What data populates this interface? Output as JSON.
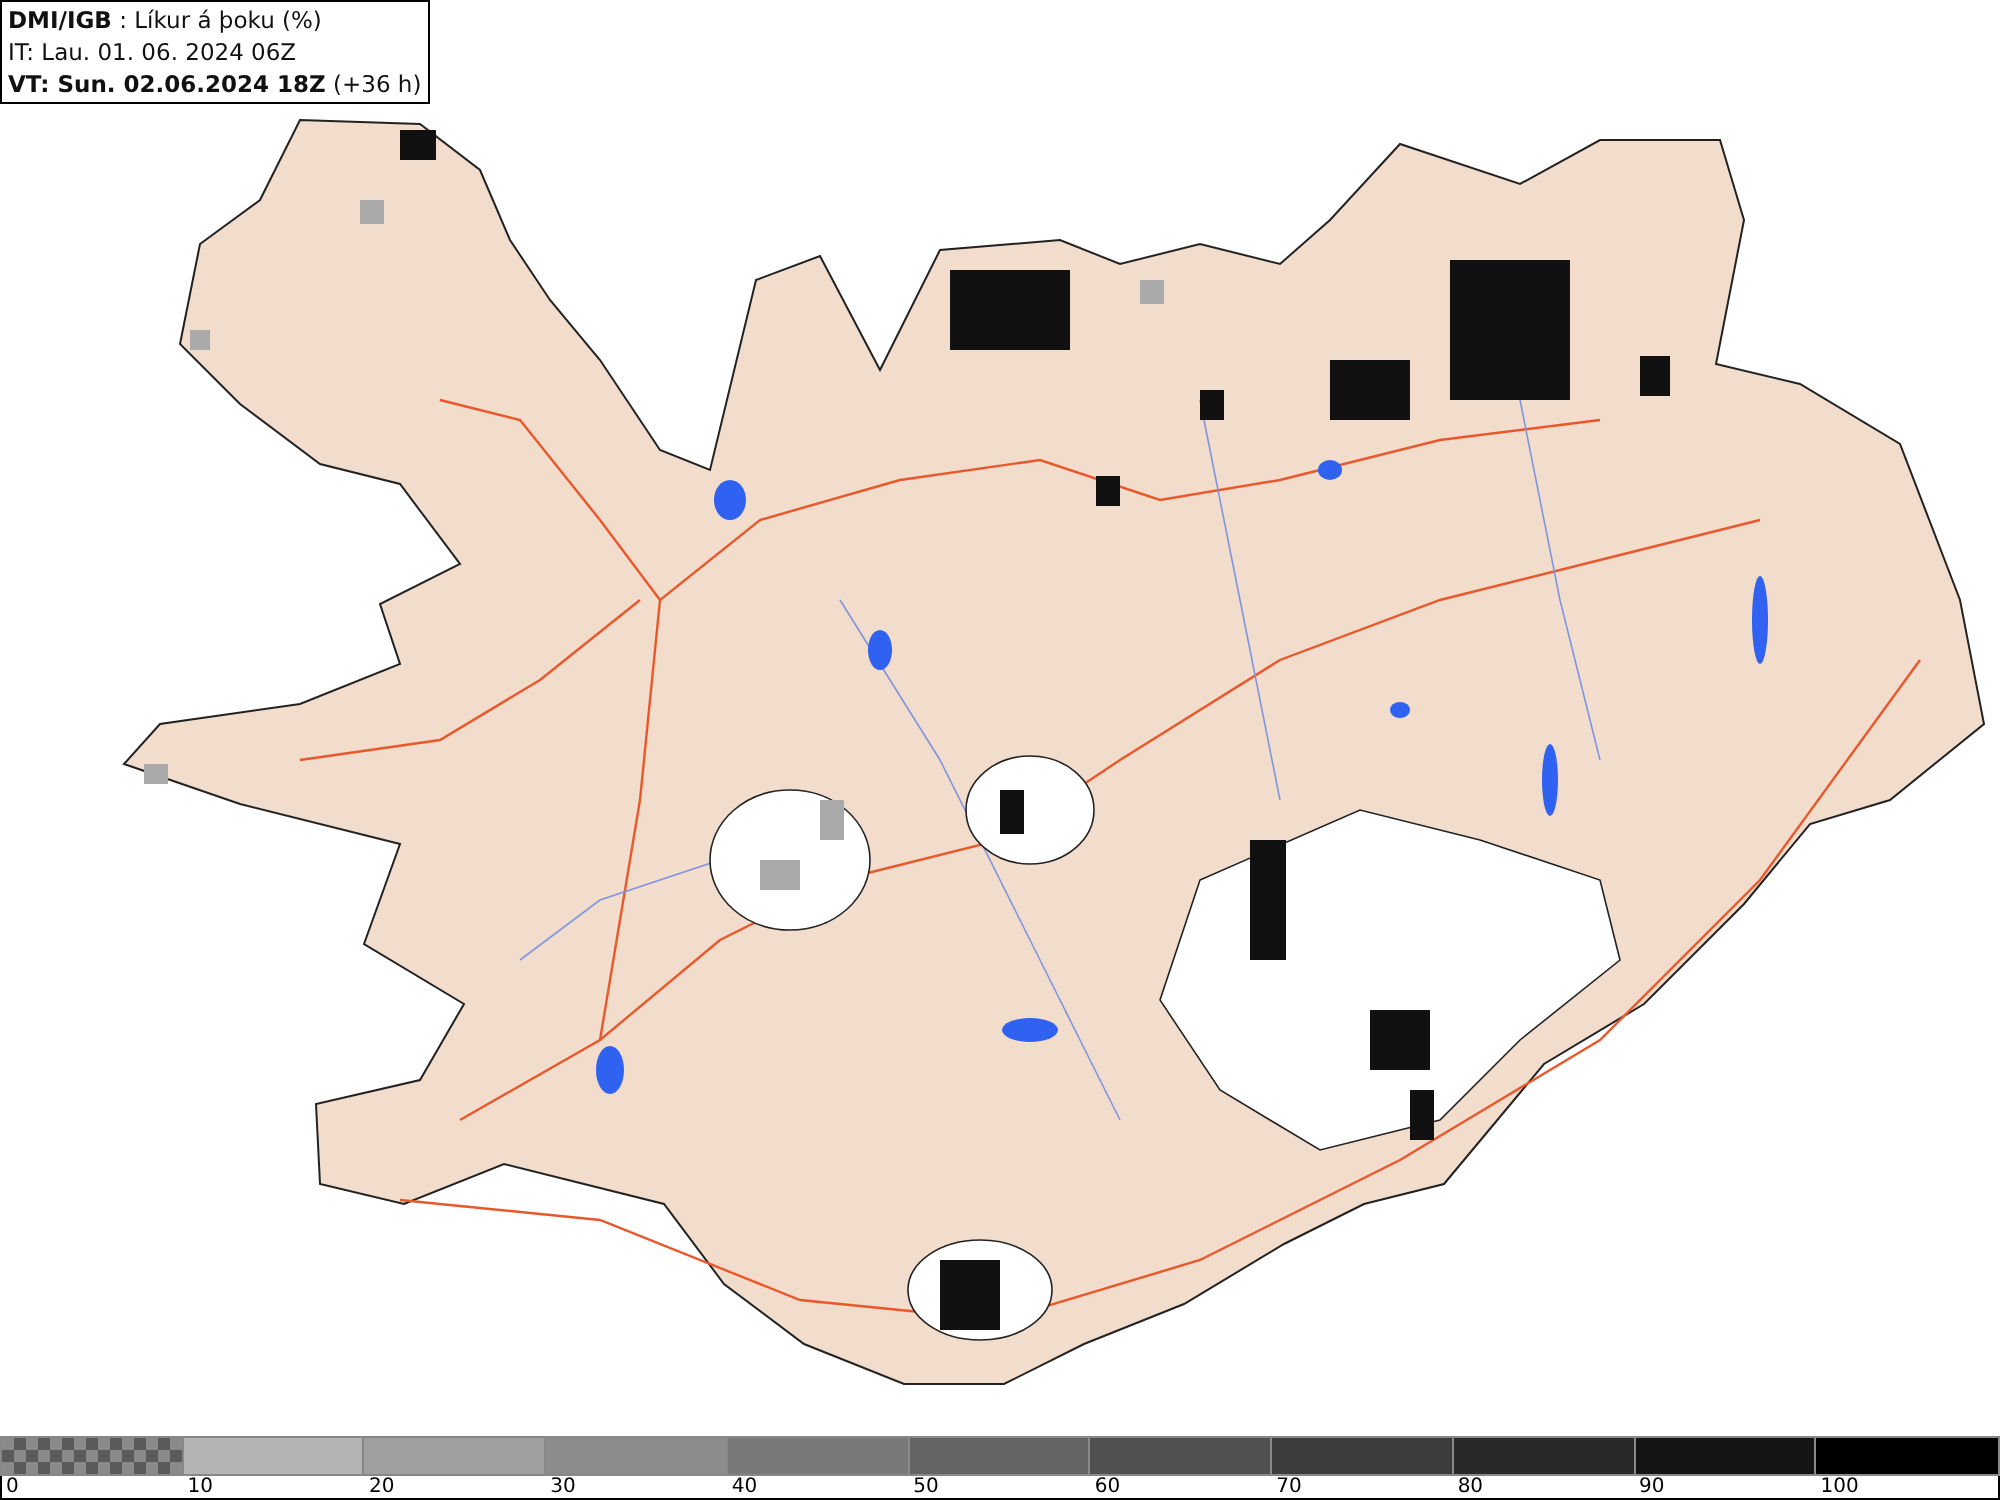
{
  "header": {
    "lines": [
      "**DMI/IGB** : Líkur á þoku (%)",
      "IT: Lau. 01. 06. 2024 06Z",
      "**VT: Sun. 02.06.2024 18Z** (+36 h)"
    ]
  },
  "legend": {
    "swatches": [
      {
        "kind": "checker"
      },
      {
        "kind": "solid",
        "color": "#b4b4b4"
      },
      {
        "kind": "solid",
        "color": "#a0a0a0"
      },
      {
        "kind": "solid",
        "color": "#8c8c8c"
      },
      {
        "kind": "solid",
        "color": "#787878"
      },
      {
        "kind": "solid",
        "color": "#646464"
      },
      {
        "kind": "solid",
        "color": "#505050"
      },
      {
        "kind": "solid",
        "color": "#3c3c3c"
      },
      {
        "kind": "solid",
        "color": "#282828"
      },
      {
        "kind": "solid",
        "color": "#141414"
      },
      {
        "kind": "solid",
        "color": "#000000"
      }
    ],
    "labels": [
      "0",
      "10",
      "20",
      "30",
      "40",
      "50",
      "60",
      "70",
      "80",
      "90",
      "100"
    ]
  }
}
